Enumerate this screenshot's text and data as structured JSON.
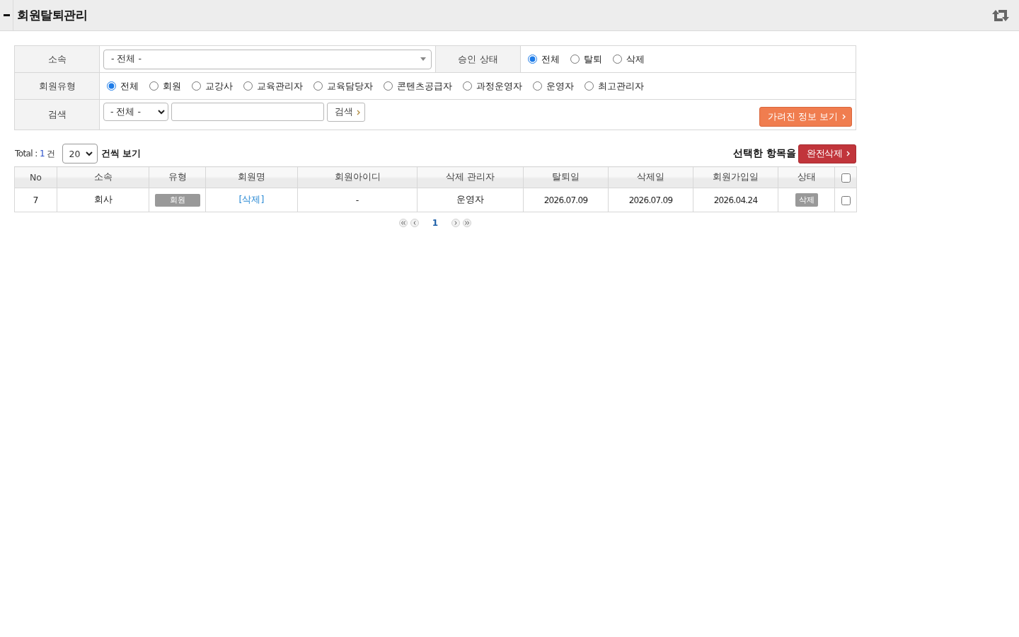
{
  "header": {
    "title": "회원탈퇴관리"
  },
  "filters": {
    "affiliation": {
      "label": "소속",
      "value": "- 전체 -"
    },
    "approval": {
      "label": "승인 상태",
      "options": [
        {
          "label": "전체",
          "selected": true
        },
        {
          "label": "탈퇴",
          "selected": false
        },
        {
          "label": "삭제",
          "selected": false
        }
      ]
    },
    "member_type": {
      "label": "회원유형",
      "options": [
        {
          "label": "전체",
          "selected": true
        },
        {
          "label": "회원",
          "selected": false
        },
        {
          "label": "교강사",
          "selected": false
        },
        {
          "label": "교육관리자",
          "selected": false
        },
        {
          "label": "교육담당자",
          "selected": false
        },
        {
          "label": "콘텐츠공급자",
          "selected": false
        },
        {
          "label": "과정운영자",
          "selected": false
        },
        {
          "label": "운영자",
          "selected": false
        },
        {
          "label": "최고관리자",
          "selected": false
        }
      ]
    },
    "search": {
      "label": "검색",
      "scope": "- 전체 -",
      "button": "검색"
    },
    "hidden_info_button": "가려진 정보 보기"
  },
  "list_toolbar": {
    "total_label": "Total :",
    "total_count": "1",
    "total_unit": "건",
    "page_size": "20",
    "page_size_suffix": "건씩 보기",
    "bulk_label": "선택한 항목을",
    "bulk_button": "완전삭제"
  },
  "table": {
    "columns": [
      "No",
      "소속",
      "유형",
      "회원명",
      "회원아이디",
      "삭제 관리자",
      "탈퇴일",
      "삭제일",
      "회원가입일",
      "상태"
    ],
    "select_all": {
      "checked": false
    },
    "rows": [
      {
        "no": "7",
        "affiliation": "회사",
        "type": "회원",
        "name": "[삭제]",
        "user_id": "-",
        "deleted_by": "운영자",
        "withdrawn_date": "2026.07.09",
        "deleted_date": "2026.07.09",
        "joined_date": "2026.04.24",
        "status": "삭제",
        "checked": false
      }
    ]
  },
  "pagination": {
    "pages": [
      {
        "label": "1",
        "selected": true
      }
    ]
  }
}
